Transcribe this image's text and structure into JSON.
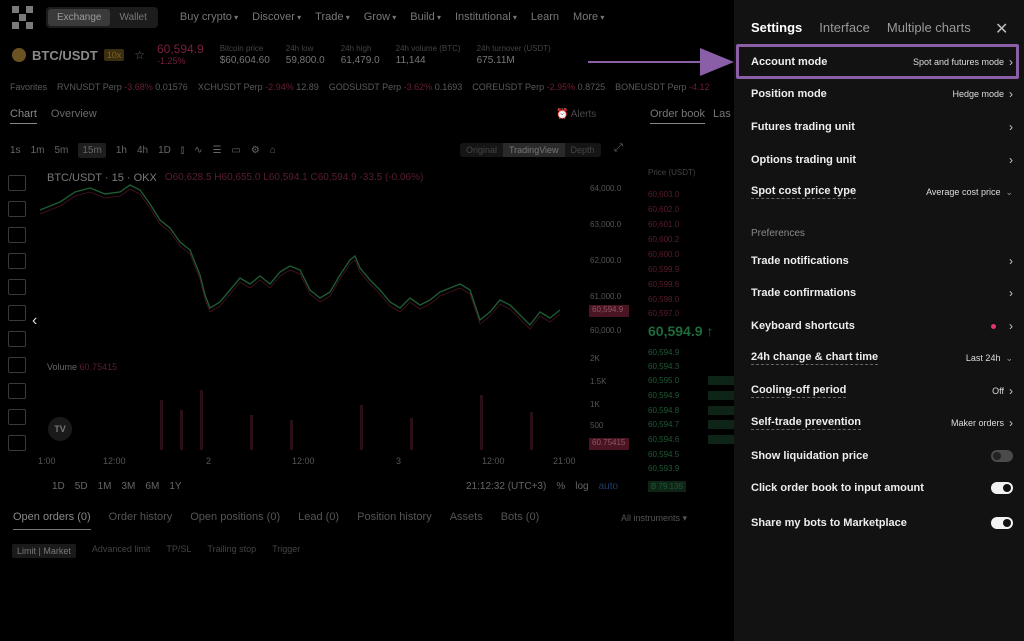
{
  "topnav": {
    "segments": [
      "Exchange",
      "Wallet"
    ],
    "items": [
      "Buy crypto",
      "Discover",
      "Trade",
      "Grow",
      "Build",
      "Institutional",
      "Learn",
      "More"
    ]
  },
  "ticker": {
    "pair": "BTC/USDT",
    "leverage": "10x",
    "price": "60,594.9",
    "change": "-1.25%",
    "stats": [
      {
        "label": "Bitcoin price",
        "value": "$60,604.60"
      },
      {
        "label": "24h low",
        "value": "59,800.0"
      },
      {
        "label": "24h high",
        "value": "61,479.0"
      },
      {
        "label": "24h volume (BTC)",
        "value": "11,144"
      },
      {
        "label": "24h turnover (USDT)",
        "value": "675.11M"
      }
    ]
  },
  "favorites": {
    "label": "Favorites",
    "items": [
      {
        "name": "RVNUSDT Perp",
        "change": "-3.68%",
        "price": "0.01576"
      },
      {
        "name": "XCHUSDT Perp",
        "change": "-2.94%",
        "price": "12.89"
      },
      {
        "name": "GODSUSDT Perp",
        "change": "-3.62%",
        "price": "0.1693"
      },
      {
        "name": "COREUSDT Perp",
        "change": "-2.95%",
        "price": "0.8725"
      },
      {
        "name": "BONEUSDT Perp",
        "change": "-4.12",
        "price": ""
      }
    ]
  },
  "chart_panel": {
    "tabs": [
      "Chart",
      "Overview"
    ],
    "alerts": "Alerts",
    "intervals": [
      "1s",
      "1m",
      "5m",
      "15m",
      "1h",
      "4h",
      "1D"
    ],
    "selected_interval": "15m",
    "views": [
      "Original",
      "TradingView",
      "Depth"
    ],
    "ohlc_title": "BTC/USDT · 15 · OKX",
    "ohlc_values": "O60,628.5 H60,655.0 L60,594.1 C60,594.9 -33.5 (-0.06%)",
    "volume_label": "Volume",
    "volume_value": "60.75415",
    "tv_logo": "TV",
    "price_axis": [
      "64,000.0",
      "63,000.0",
      "62,000.0",
      "61,000.0",
      "60,000.0"
    ],
    "current_price_badge": "60,594.9",
    "volume_axis": [
      "2K",
      "1.5K",
      "1K",
      "500"
    ],
    "volume_badge": "60.75415",
    "time_axis": [
      "1:00",
      "12:00",
      "2",
      "12:00",
      "3",
      "12:00",
      "21:00"
    ],
    "ranges": [
      "1D",
      "5D",
      "1M",
      "3M",
      "6M",
      "1Y"
    ],
    "clock": "21:12:32 (UTC+3)",
    "scale_options": [
      "%",
      "log",
      "auto"
    ]
  },
  "order_book": {
    "tabs": [
      "Order book",
      "Las"
    ],
    "header": "Price (USDT)",
    "asks": [
      "60,603.0",
      "60,602.0",
      "60,601.0",
      "60,600.2",
      "60,600.0",
      "60,599.9",
      "60,599.6",
      "60,598.0",
      "60,597.0"
    ],
    "mid_price": "60,594.9 ↑",
    "bids": [
      "60,594.9",
      "60,594.3",
      "60,595.0",
      "60,594.9",
      "60,594.8",
      "60,594.7",
      "60,594.6",
      "60,594.5",
      "60,593.9"
    ],
    "footer": "B 79.135"
  },
  "bottom": {
    "tabs": [
      "Open orders (0)",
      "Order history",
      "Open positions (0)",
      "Lead (0)",
      "Position history",
      "Assets",
      "Bots (0)"
    ],
    "instruments": "All instruments",
    "order_types": [
      "Limit | Market",
      "Advanced limit",
      "TP/SL",
      "Trailing stop",
      "Trigger"
    ]
  },
  "settings": {
    "tabs": [
      "Settings",
      "Interface",
      "Multiple charts"
    ],
    "rows": [
      {
        "label": "Account mode",
        "value": "Spot and futures mode"
      },
      {
        "label": "Position mode",
        "value": "Hedge mode"
      },
      {
        "label": "Futures trading unit",
        "value": ""
      },
      {
        "label": "Options trading unit",
        "value": ""
      },
      {
        "label": "Spot cost price type",
        "value": "Average cost price"
      }
    ],
    "preferences_label": "Preferences",
    "pref_rows": [
      {
        "label": "Trade notifications",
        "value": ""
      },
      {
        "label": "Trade confirmations",
        "value": ""
      },
      {
        "label": "Keyboard shortcuts",
        "value": ""
      },
      {
        "label": "24h change & chart time",
        "value": "Last 24h"
      },
      {
        "label": "Cooling-off period",
        "value": "Off"
      },
      {
        "label": "Self-trade prevention",
        "value": "Maker orders"
      }
    ],
    "toggles": [
      {
        "label": "Show liquidation price",
        "state": "off"
      },
      {
        "label": "Click order book to input amount",
        "state": "on"
      },
      {
        "label": "Share my bots to Marketplace",
        "state": "on"
      }
    ]
  },
  "colors": {
    "highlight": "#8a5fa8",
    "accent_red": "#e6336b",
    "panel_bg": "#121212"
  }
}
